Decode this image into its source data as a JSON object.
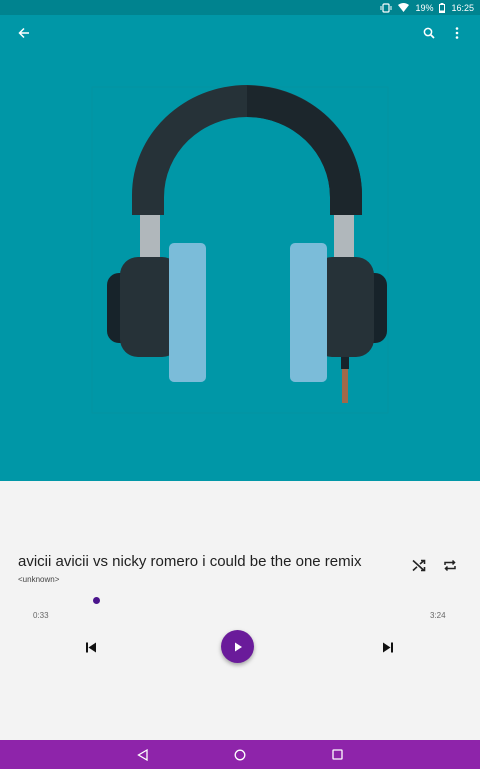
{
  "status_bar": {
    "battery": "19%",
    "time": "16:25",
    "icons": [
      "vibrate-icon",
      "wifi-icon",
      "battery-icon"
    ]
  },
  "toolbar": {
    "back_icon": "arrow-back-icon",
    "search_icon": "search-icon",
    "more_icon": "more-vert-icon"
  },
  "album_art": {
    "icon": "headphones-icon",
    "background_color": "#0097a7"
  },
  "track": {
    "title": "avicii avicii vs nicky romero i could be the one remix",
    "artist": "<unknown>"
  },
  "playback": {
    "elapsed": "0:33",
    "total": "3:24",
    "progress": 0.16,
    "accent_color": "#6a1b9a"
  },
  "controls": {
    "shuffle_icon": "shuffle-icon",
    "repeat_icon": "repeat-icon",
    "prev_icon": "skip-previous-icon",
    "play_icon": "play-icon",
    "next_icon": "skip-next-icon"
  },
  "nav_bar": {
    "color": "#8e24aa",
    "icons": [
      "nav-back-icon",
      "nav-home-icon",
      "nav-recents-icon"
    ]
  }
}
